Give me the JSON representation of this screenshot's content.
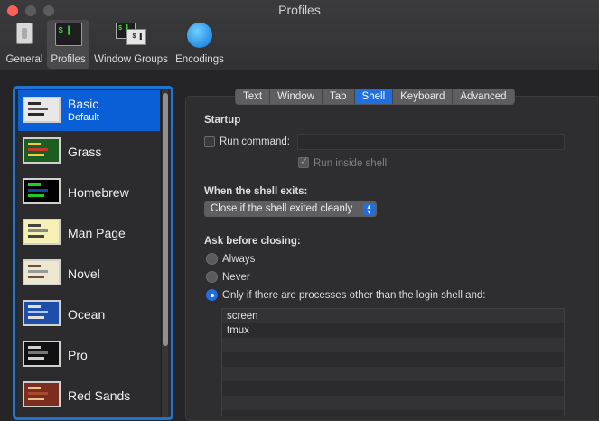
{
  "window": {
    "title": "Profiles"
  },
  "toolbar": {
    "items": [
      {
        "label": "General",
        "icon": "light-switch-icon"
      },
      {
        "label": "Profiles",
        "icon": "terminal-icon",
        "term_text": "$ ▌"
      },
      {
        "label": "Window Groups",
        "icon": "window-groups-icon",
        "term_a": "$ ▌",
        "term_b": "$ ▌"
      },
      {
        "label": "Encodings",
        "icon": "globe-icon"
      }
    ]
  },
  "profiles": [
    {
      "name": "Basic",
      "sub": "Default",
      "colors": [
        "#e8e8e8",
        "#2a2a2a",
        "#555"
      ]
    },
    {
      "name": "Grass",
      "sub": "",
      "colors": [
        "#1b5e20",
        "#f2c94c",
        "#c0392b"
      ]
    },
    {
      "name": "Homebrew",
      "sub": "",
      "colors": [
        "#000000",
        "#22cc22",
        "#0d47a1"
      ]
    },
    {
      "name": "Man Page",
      "sub": "",
      "colors": [
        "#f6f0b4",
        "#444",
        "#888"
      ]
    },
    {
      "name": "Novel",
      "sub": "",
      "colors": [
        "#efe6cf",
        "#6b4f3a",
        "#999"
      ]
    },
    {
      "name": "Ocean",
      "sub": "",
      "colors": [
        "#1e4fa8",
        "#e0e0e0",
        "#aac4ff"
      ]
    },
    {
      "name": "Pro",
      "sub": "",
      "colors": [
        "#111111",
        "#d0d0d0",
        "#777"
      ]
    },
    {
      "name": "Red Sands",
      "sub": "",
      "colors": [
        "#7b2d1f",
        "#e8c28a",
        "#a84b32"
      ]
    }
  ],
  "tabs": [
    {
      "label": "Text",
      "selected": false
    },
    {
      "label": "Window",
      "selected": false
    },
    {
      "label": "Tab",
      "selected": false
    },
    {
      "label": "Shell",
      "selected": true
    },
    {
      "label": "Keyboard",
      "selected": false
    },
    {
      "label": "Advanced",
      "selected": false
    }
  ],
  "startup": {
    "heading": "Startup",
    "run_command_label": "Run command:",
    "run_command_value": "",
    "run_inside_shell_label": "Run inside shell"
  },
  "shell_exit": {
    "heading": "When the shell exits:",
    "selected": "Close if the shell exited cleanly"
  },
  "ask_before_closing": {
    "heading": "Ask before closing:",
    "options": [
      "Always",
      "Never",
      "Only if there are processes other than the login shell and:"
    ],
    "selected_index": 2
  },
  "processes": [
    "screen",
    "tmux",
    "",
    "",
    "",
    "",
    ""
  ],
  "accent": "#1f6fe0"
}
